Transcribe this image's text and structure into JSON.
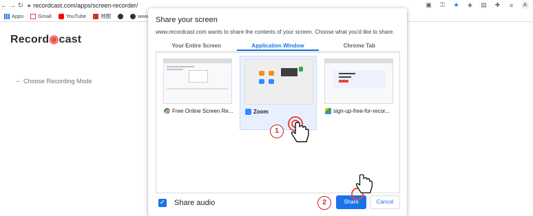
{
  "browser": {
    "url": "recordcast.com/apps/screen-recorder/",
    "bookmarks": [
      {
        "label": "Apps",
        "icon": "apps-grid-icon"
      },
      {
        "label": "Gmail",
        "icon": "gmail-icon"
      },
      {
        "label": "YouTube",
        "icon": "youtube-icon"
      },
      {
        "label": "地图",
        "icon": "maps-icon"
      },
      {
        "label": "",
        "icon": "link-icon"
      },
      {
        "label": "www.",
        "icon": "site-icon"
      }
    ],
    "avatar_initial": "A"
  },
  "page": {
    "logo_text_a": "Record",
    "logo_text_b": "cast",
    "back_link": "Choose Recording Mode"
  },
  "dialog": {
    "title": "Share your screen",
    "description": "www.recordcast.com wants to share the contents of your screen. Choose what you'd like to share.",
    "tabs": [
      {
        "label": "Your Entire Screen",
        "active": false
      },
      {
        "label": "Application Window",
        "active": true
      },
      {
        "label": "Chrome Tab",
        "active": false
      }
    ],
    "windows": [
      {
        "label": "Free Online Screen Re...",
        "icon": "chrome-icon",
        "selected": false
      },
      {
        "label": "Zoom",
        "icon": "zoom-icon",
        "selected": true
      },
      {
        "label": "sign-up-free-for-recor...",
        "icon": "google-sheets-icon",
        "selected": false
      }
    ],
    "share_audio_label": "Share audio",
    "share_audio_checked": true,
    "share_button": "Share",
    "cancel_button": "Cancel"
  },
  "annotations": {
    "step1": "1",
    "step2": "2"
  },
  "colors": {
    "accent": "#1a73e8",
    "brand": "#e8473b",
    "step_marker": "#c5221f"
  }
}
